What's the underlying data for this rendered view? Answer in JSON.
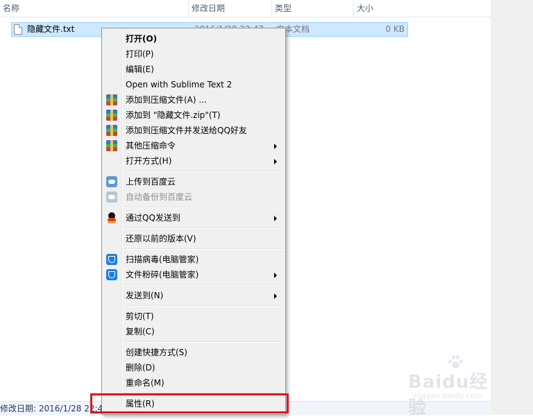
{
  "columns": {
    "name": "名称",
    "date": "修改日期",
    "type": "类型",
    "size": "大小"
  },
  "file": {
    "name": "隐藏文件.txt",
    "date": "2016/1/28 22:47",
    "type": "文本文档",
    "size": "0 KB"
  },
  "status": {
    "text": "修改日期: 2016/1/28 22:47"
  },
  "menu": {
    "open": "打开(O)",
    "print": "打印(P)",
    "edit": "编辑(E)",
    "sublime": "Open with Sublime Text 2",
    "add_archive": "添加到压缩文件(A) ...",
    "add_zip": "添加到 \"隐藏文件.zip\"(T)",
    "add_send_qq": "添加到压缩文件并发送给QQ好友",
    "other_compress": "其他压缩命令",
    "open_with": "打开方式(H)",
    "upload_baidu": "上传到百度云",
    "auto_backup": "自动备份到百度云",
    "send_qq": "通过QQ发送到",
    "restore": "还原以前的版本(V)",
    "scan_virus": "扫描病毒(电脑管家)",
    "shred": "文件粉碎(电脑管家)",
    "send_to": "发送到(N)",
    "cut": "剪切(T)",
    "copy": "复制(C)",
    "shortcut": "创建快捷方式(S)",
    "delete": "删除(D)",
    "rename": "重命名(M)",
    "properties": "属性(R)"
  },
  "icons": {
    "winrar": "winrar-icon",
    "baidu_cloud": "baidu-cloud-icon",
    "qq": "qq-penguin-icon",
    "pc_manager": "pc-manager-shield-icon",
    "submenu": "submenu-arrow-icon"
  },
  "watermark": {
    "logo": "Baidu经验",
    "sub": "jingyan.baidu.com"
  },
  "colors": {
    "highlight": "#e0141e",
    "selection": "#cde8ff"
  }
}
